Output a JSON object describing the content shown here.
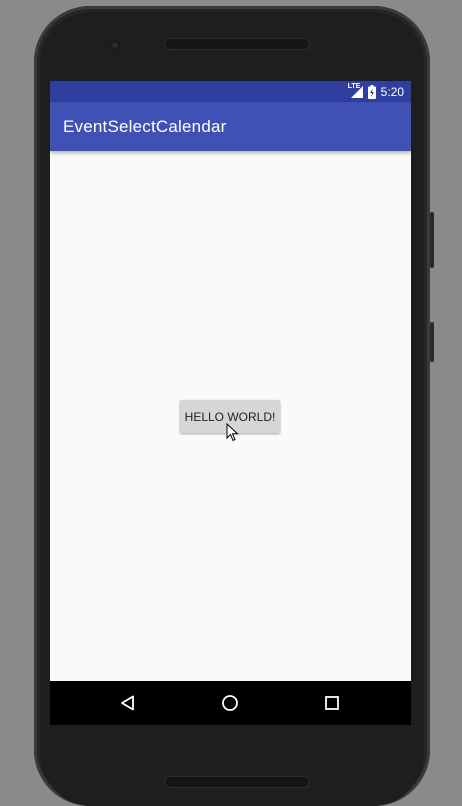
{
  "status_bar": {
    "network_label": "LTE",
    "time": "5:20",
    "color": "#303f9f"
  },
  "app_bar": {
    "title": "EventSelectCalendar",
    "color": "#3f51b5"
  },
  "content": {
    "button_label": "HELLO WORLD!"
  },
  "nav_bar": {
    "back_icon": "back-triangle-icon",
    "home_icon": "home-circle-icon",
    "recents_icon": "recents-square-icon"
  }
}
